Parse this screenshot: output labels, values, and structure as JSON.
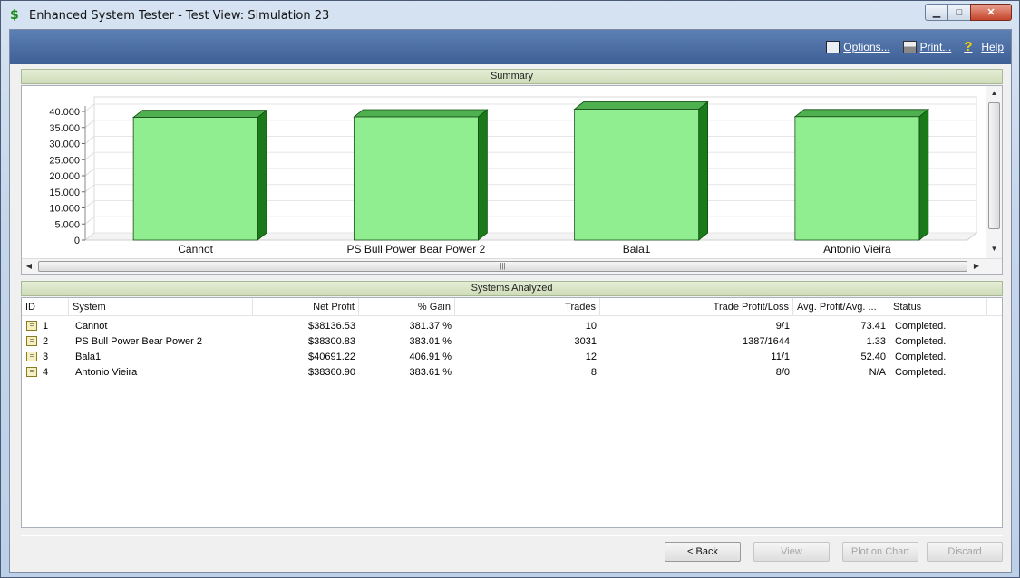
{
  "window": {
    "title": "Enhanced System Tester - Test View: Simulation 23",
    "minimize": "▁",
    "maximize": "□",
    "close": "✕",
    "app_icon": "$"
  },
  "toolbar": {
    "options_label": "Options...",
    "print_label": "Print...",
    "help_label": "Help",
    "help_icon": "?"
  },
  "summary": {
    "title": "Summary"
  },
  "chart_data": {
    "type": "bar",
    "categories": [
      "Cannot",
      "PS Bull Power Bear Power 2",
      "Bala1",
      "Antonio Vieira"
    ],
    "values": [
      38136.53,
      38300.83,
      40691.22,
      38360.9
    ],
    "ylim": [
      0,
      40000
    ],
    "yticks": [
      "40.000",
      "35.000",
      "30.000",
      "25.000",
      "20.000",
      "15.000",
      "10.000",
      "5.000",
      "0"
    ],
    "bar_color": "#90ee90",
    "bar_side_color": "#1a7a1a",
    "bar_top_color": "#4fb04f",
    "grid": true
  },
  "systems": {
    "title": "Systems Analyzed",
    "columns": [
      "ID",
      "System",
      "Net Profit",
      "% Gain",
      "Trades",
      "Trade Profit/Loss",
      "Avg. Profit/Avg. ...",
      "Status"
    ],
    "rows": [
      {
        "id": "1",
        "system": "Cannot",
        "net_profit": "$38136.53",
        "gain": "381.37 %",
        "trades": "10",
        "trade_pl": "9/1",
        "avg": "73.41",
        "status": "Completed."
      },
      {
        "id": "2",
        "system": "PS Bull Power Bear Power 2",
        "net_profit": "$38300.83",
        "gain": "383.01 %",
        "trades": "3031",
        "trade_pl": "1387/1644",
        "avg": "1.33",
        "status": "Completed."
      },
      {
        "id": "3",
        "system": "Bala1",
        "net_profit": "$40691.22",
        "gain": "406.91 %",
        "trades": "12",
        "trade_pl": "11/1",
        "avg": "52.40",
        "status": "Completed."
      },
      {
        "id": "4",
        "system": "Antonio Vieira",
        "net_profit": "$38360.90",
        "gain": "383.61 %",
        "trades": "8",
        "trade_pl": "8/0",
        "avg": "N/A",
        "status": "Completed."
      }
    ]
  },
  "buttons": {
    "back": "< Back",
    "view": "View",
    "plot_on_chart": "Plot on Chart",
    "discard": "Discard"
  }
}
